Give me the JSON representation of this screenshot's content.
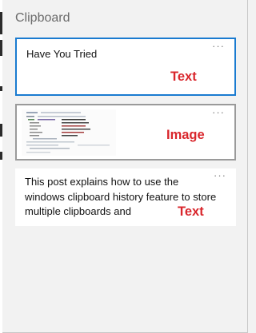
{
  "panel": {
    "title": "Clipboard"
  },
  "items": [
    {
      "kind": "text",
      "text": "Have You Tried",
      "more": "···",
      "label": "Text",
      "selected": true
    },
    {
      "kind": "image",
      "text": "",
      "more": "···",
      "label": "Image",
      "selected": false
    },
    {
      "kind": "text",
      "text": "This post explains how to use the windows clipboard history feature to store multiple clipboards and",
      "more": "···",
      "label": "Text",
      "selected": false
    }
  ],
  "colors": {
    "accent": "#1a7bd0",
    "label": "#d9262c",
    "background": "#f2f2f2"
  }
}
